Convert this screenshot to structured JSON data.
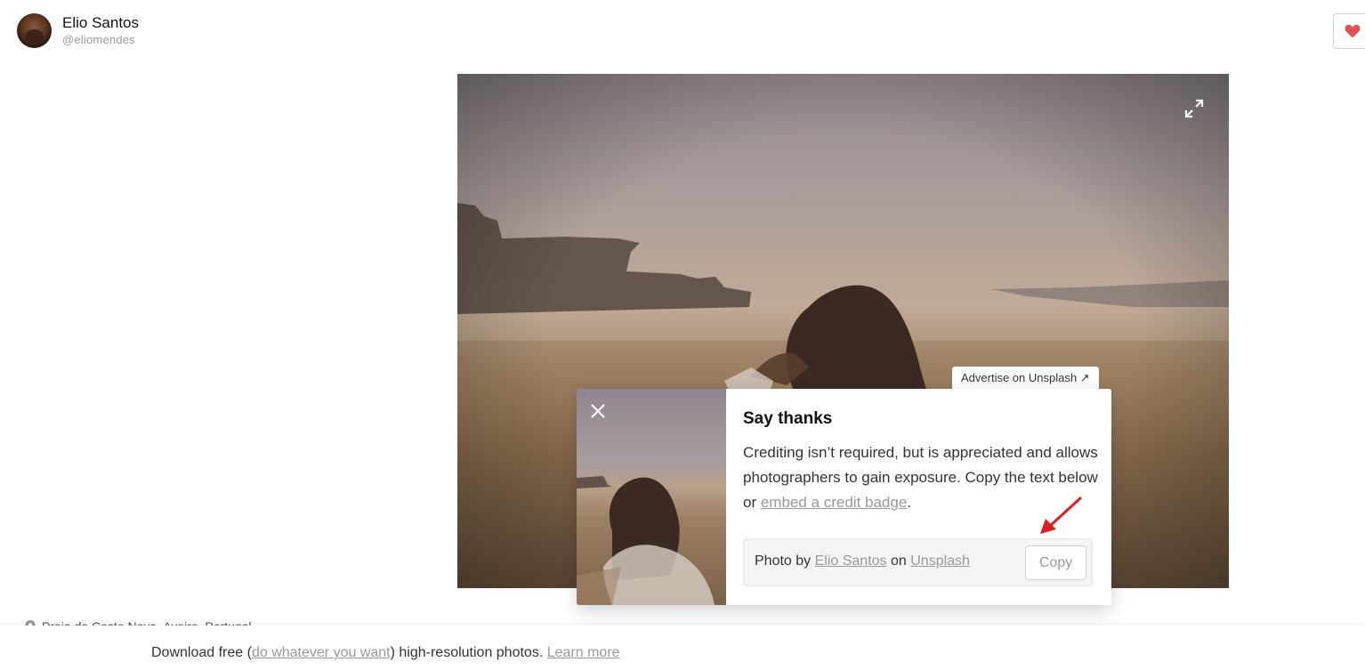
{
  "header": {
    "user_name": "Elio Santos",
    "user_handle": "@eliomendes"
  },
  "photo": {
    "advertise_label": "Advertise on Unsplash ↗"
  },
  "modal": {
    "title": "Say thanks",
    "text_part1": "Crediting isn’t required, but is appreciated and allows photographers to gain exposure. Copy the text below or ",
    "link_embed": "embed a credit badge",
    "text_part2": ".",
    "credit_prefix": "Photo by ",
    "credit_author": "Elio Santos",
    "credit_middle": " on ",
    "credit_site": "Unsplash",
    "copy_label": "Copy"
  },
  "location": {
    "text": "Praia da Costa Nova, Aveiro, Portugal"
  },
  "bottom_bar": {
    "text_prefix": "Download free (",
    "link_license": "do whatever you want",
    "text_middle": ") high-resolution photos. ",
    "link_learn_more": "Learn more"
  },
  "colors": {
    "heart": "#e05250",
    "annotation_arrow": "#e01e1e"
  },
  "icons": {
    "like": "heart-icon",
    "expand": "expand-icon",
    "close": "close-icon",
    "location": "map-pin-icon"
  }
}
